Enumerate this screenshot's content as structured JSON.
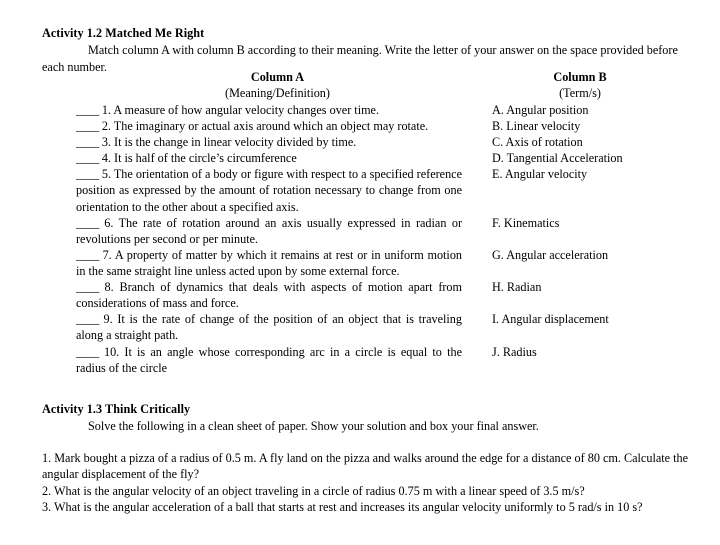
{
  "document": {
    "activity_1_2": {
      "title": "Activity 1.2 Matched Me Right",
      "instruction": "Match column A with column B according to their meaning. Write the letter of your answer on the space provided before each number.",
      "column_a_heading": "Column A",
      "column_a_subheading": "(Meaning/Definition)",
      "column_b_heading": "Column B",
      "column_b_subheading": "(Term/s)",
      "blank_line": "____",
      "items": [
        {
          "number": "1.",
          "definition": "A measure of how angular velocity changes over time.",
          "term": "A. Angular position"
        },
        {
          "number": "2.",
          "definition": "The imaginary or actual axis around which an object may rotate.",
          "term": "B. Linear velocity"
        },
        {
          "number": "3.",
          "definition": "It is the change in linear velocity divided by time.",
          "term": "C. Axis of rotation"
        },
        {
          "number": "4.",
          "definition": "It is half of the circle’s circumference",
          "term": "D. Tangential Acceleration"
        },
        {
          "number": "5.",
          "definition": "The orientation of a body or figure with respect to a specified reference position as expressed by the amount of rotation necessary to change from one orientation to the other about a specified axis.",
          "term": "E. Angular velocity"
        },
        {
          "number": "6.",
          "definition": "The rate of rotation around an axis usually expressed in radian or revolutions per second or per minute.",
          "term": "F. Kinematics"
        },
        {
          "number": "7.",
          "definition": "A property of matter by which it remains at rest or in uniform motion in the same straight line unless acted upon by some external force.",
          "term": "G. Angular acceleration"
        },
        {
          "number": "8.",
          "definition": "Branch of dynamics that deals with aspects of motion apart from considerations of mass and force.",
          "term": "H. Radian"
        },
        {
          "number": "9.",
          "definition": "It is the rate of change of the position of an object that is traveling along a straight path.",
          "term": "I.  Angular displacement"
        },
        {
          "number": "10.",
          "definition": "It is an angle whose corresponding arc in a circle is equal to the radius of the circle",
          "term": "J. Radius"
        }
      ]
    },
    "activity_1_3": {
      "title": "Activity 1.3 Think Critically",
      "instruction": "Solve the following in a clean sheet of paper. Show your solution and box your final answer.",
      "questions": [
        "1. Mark bought a pizza of a radius of 0.5 m. A fly land on the pizza and walks around the edge for a distance of 80 cm. Calculate the angular displacement of the fly?",
        "2. What is the angular velocity of an object traveling in a circle of radius 0.75 m with a linear speed of 3.5 m/s?",
        "3. What is the angular acceleration of a ball that starts at rest and increases its angular velocity uniformly to 5 rad/s in 10 s?"
      ]
    }
  }
}
